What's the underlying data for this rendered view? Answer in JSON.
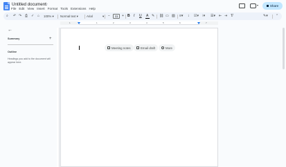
{
  "header": {
    "doc_title": "Untitled document",
    "menu": [
      "File",
      "Edit",
      "View",
      "Insert",
      "Format",
      "Tools",
      "Extensions",
      "Help"
    ],
    "share_label": "Share"
  },
  "toolbar": {
    "zoom": "100%",
    "style": "Normal text",
    "font": "Arial",
    "font_size": "11",
    "minus": "−",
    "plus": "+",
    "bold": "B",
    "italic": "I",
    "underline": "U",
    "text_color": "A"
  },
  "ruler": {
    "numbers": [
      "1",
      "1",
      "2",
      "3",
      "4",
      "5",
      "6",
      "7"
    ]
  },
  "outline": {
    "summary_label": "Summary",
    "summary_add": "+",
    "outline_label": "Outline",
    "help_text": "Headings you add to the document will appear here."
  },
  "chips": {
    "meeting_notes": "Meeting notes",
    "email_draft": "Email draft",
    "more": "More"
  },
  "colors": {
    "brand": "#4285f4",
    "share_bg": "#c2e7ff",
    "toolbar_bg": "#edf2fa"
  }
}
